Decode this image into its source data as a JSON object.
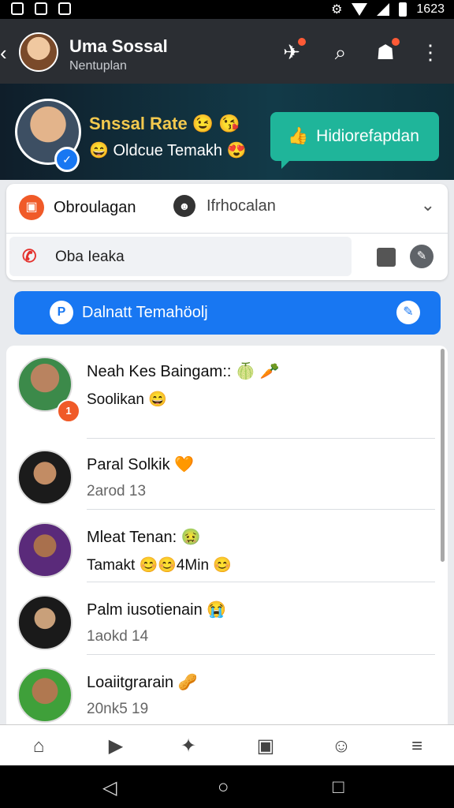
{
  "status": {
    "time": "1623"
  },
  "appbar": {
    "title": "Uma Sossal",
    "subtitle": "Nentuplan"
  },
  "banner": {
    "title": "Snssal Rate 😉 😘",
    "subtitle": "😄 Oldcue Temakh 😍",
    "button_label": "Hidiorefapdan"
  },
  "tabs": [
    {
      "label": "Obroulagan"
    },
    {
      "label": "Ifrhocalan"
    }
  ],
  "search": {
    "value": "Oba Ieaka"
  },
  "cta": {
    "label": "Dalnatt Temahöolj"
  },
  "chats": [
    {
      "name": "Neah Kes Baingam:: 🍈 🥕",
      "message": "Soolikan 😄",
      "badge": "1"
    },
    {
      "name": "Paral Solkik 🧡",
      "message": "2arod  13"
    },
    {
      "name": "Mleat Tenan: 🤢",
      "message": "Tamakt 😊😊4Min 😊"
    },
    {
      "name": "Palm iusotienain 😭",
      "message": "1aokd  14"
    },
    {
      "name": "Loaiitgrarain 🥜",
      "message": "20nk5  19"
    }
  ],
  "colors": {
    "accent": "#1877f2",
    "appbar": "#2b2e33",
    "banner_button": "#1fb59a",
    "badge": "#f05a28"
  }
}
